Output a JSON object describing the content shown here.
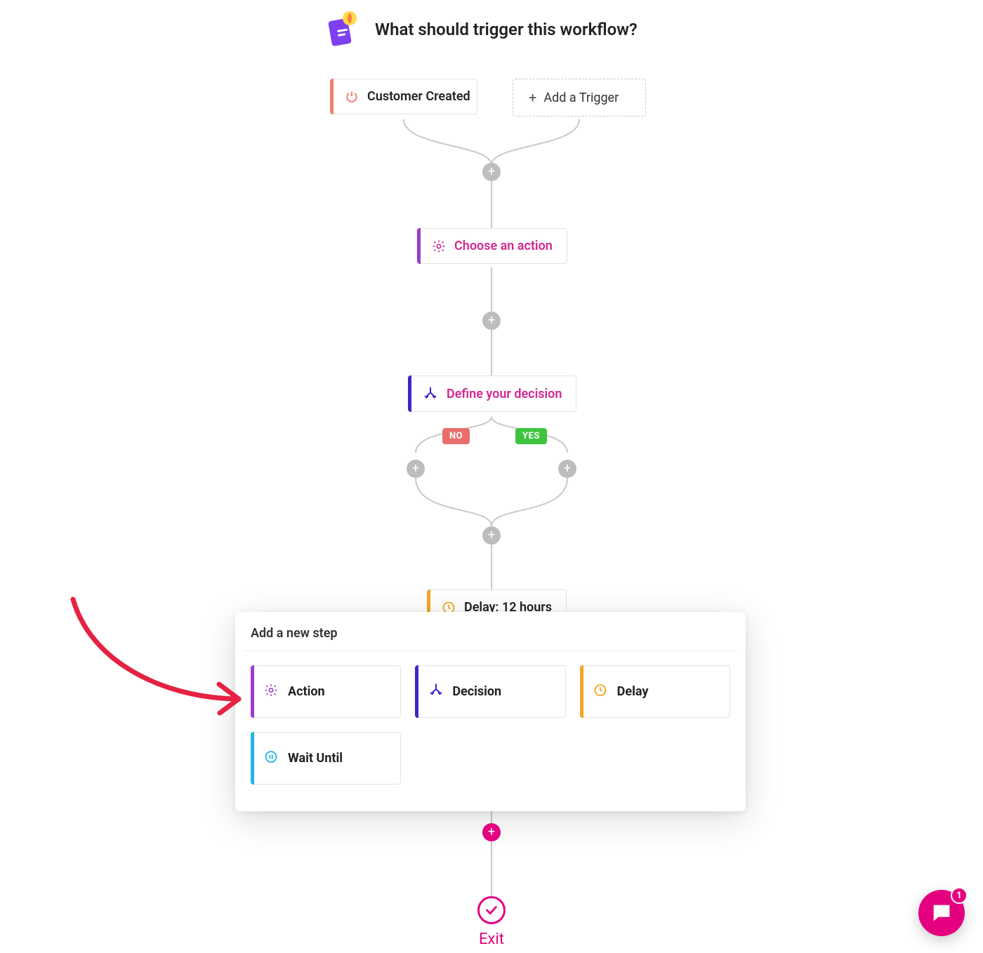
{
  "header": {
    "title": "What should trigger this workflow?"
  },
  "triggers": {
    "card_label": "Customer Created",
    "add_label": "Add a Trigger"
  },
  "nodes": {
    "action_placeholder": "Choose an action",
    "decision_placeholder": "Define your decision",
    "delay_label": "Delay: 12 hours"
  },
  "branches": {
    "no": "NO",
    "yes": "YES"
  },
  "popover": {
    "title": "Add a new step",
    "options": {
      "action": "Action",
      "decision": "Decision",
      "delay": "Delay",
      "wait_until": "Wait Until"
    }
  },
  "exit": {
    "label": "Exit"
  },
  "chat": {
    "unread": "1"
  },
  "colors": {
    "trigger_accent": "#f27e6e",
    "action_accent": "#9b3cc7",
    "decision_accent": "#3e26c9",
    "delay_accent": "#f5a623",
    "wait_accent": "#1fb6e6",
    "pink": "#e4007f"
  }
}
